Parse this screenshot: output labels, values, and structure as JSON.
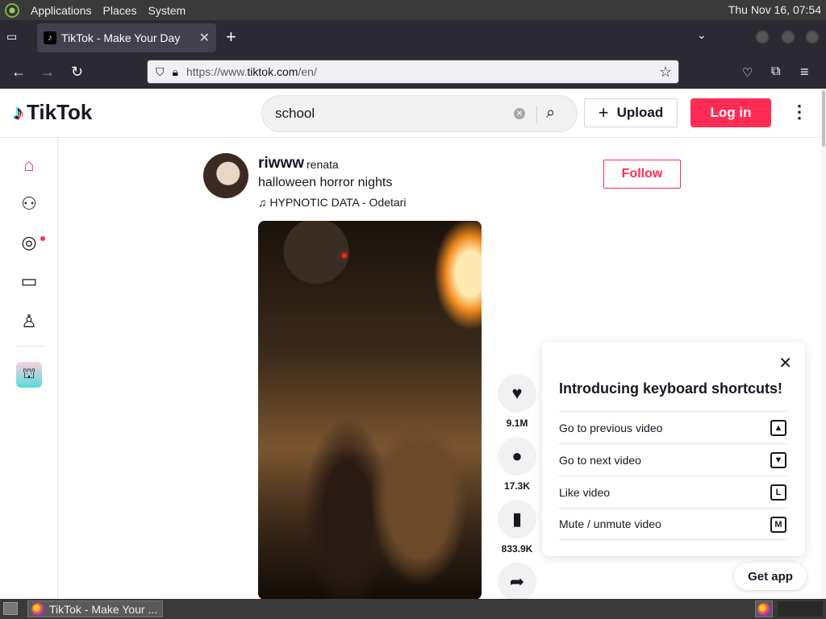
{
  "system": {
    "menus": [
      "Applications",
      "Places",
      "System"
    ],
    "clock": "Thu Nov 16, 07:54"
  },
  "browser": {
    "tab_title": "TikTok - Make Your Day",
    "url_prefix": "https://www.",
    "url_host": "tiktok.com",
    "url_path": "/en/"
  },
  "tiktok": {
    "logo": "TikTok",
    "search_value": "school",
    "upload_label": "Upload",
    "login_label": "Log in",
    "post": {
      "username": "riwww",
      "nickname": "renata",
      "caption": "halloween horror nights",
      "music": "HYPNOTIC DATA - Odetari",
      "follow_label": "Follow"
    },
    "actions": {
      "likes": "9.1M",
      "comments": "17.3K",
      "saves": "833.9K"
    },
    "shortcuts": {
      "title": "Introducing keyboard shortcuts!",
      "items": [
        {
          "label": "Go to previous video",
          "key": "▲"
        },
        {
          "label": "Go to next video",
          "key": "▼"
        },
        {
          "label": "Like video",
          "key": "L"
        },
        {
          "label": "Mute / unmute video",
          "key": "M"
        }
      ]
    },
    "get_app_label": "Get app"
  },
  "taskbar": {
    "task_label": "TikTok - Make Your ..."
  }
}
